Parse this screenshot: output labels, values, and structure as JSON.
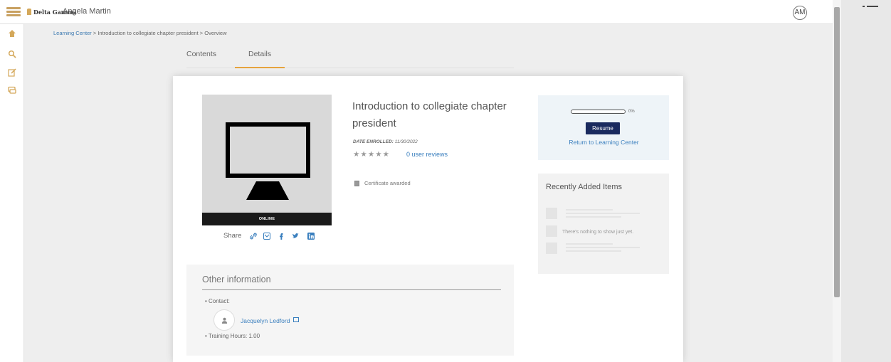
{
  "header": {
    "brand": "Delta Gamma",
    "user_name": "Angela Martin",
    "user_initials": "AM"
  },
  "breadcrumb": {
    "learning_center": "Learning Center",
    "rest": " > Introduction to collegiate chapter president > Overview"
  },
  "tabs": {
    "contents": "Contents",
    "details": "Details"
  },
  "course": {
    "title": "Introduction to collegiate chapter president",
    "date_enrolled_label": "DATE ENROLLED:",
    "date_enrolled_value": "11/30/2022",
    "reviews": "0 user reviews",
    "thumbnail_label": "ONLINE",
    "certificate": "Certificate awarded",
    "share_label": "Share"
  },
  "progress": {
    "percent": 0,
    "percent_label": "0%",
    "resume_label": "Resume",
    "return_label": "Return to Learning Center"
  },
  "recent": {
    "title": "Recently Added Items",
    "empty_text": "There's nothing to show just yet."
  },
  "info": {
    "title": "Other information",
    "contact_label": "Contact:",
    "contact_name": "Jacquelyn Ledford",
    "training_hours": "Training Hours: 1.00"
  },
  "colors": {
    "accent": "#e6a33d",
    "link": "#3a7fbe",
    "button": "#1a2a5e"
  },
  "icons": [
    "menu-icon",
    "home-icon",
    "search-icon",
    "edit-icon",
    "chat-icon",
    "link-icon",
    "email-icon",
    "facebook-icon",
    "twitter-icon",
    "linkedin-icon",
    "certificate-icon",
    "user-icon",
    "mail-icon"
  ]
}
